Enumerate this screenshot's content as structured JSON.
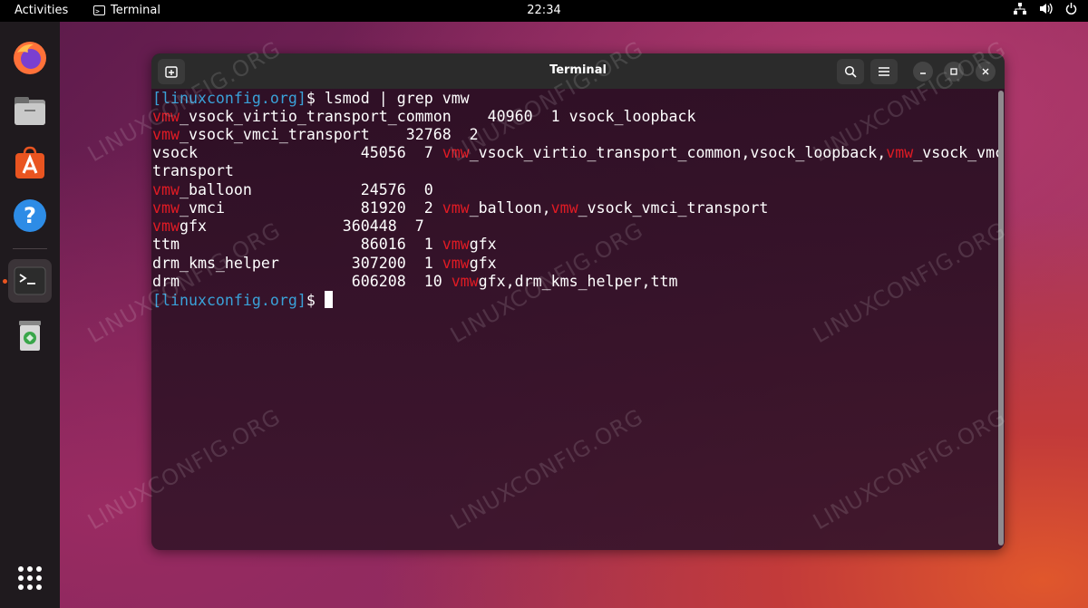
{
  "topbar": {
    "activities": "Activities",
    "app_name": "Terminal",
    "clock": "22:34"
  },
  "dock": {
    "items": [
      "firefox",
      "files",
      "software",
      "help",
      "terminal",
      "trash",
      "show-apps"
    ]
  },
  "window": {
    "title": "Terminal"
  },
  "terminal": {
    "prompt": "[linuxconfig.org]",
    "command": "$ lsmod | grep vmw",
    "lines": [
      {
        "hl1": "vmw",
        "text1": "_vsock_virtio_transport_common    40960  1 vsock_loopback",
        "hl2": "",
        "text2": ""
      },
      {
        "hl1": "vmw",
        "text1": "_vsock_vmci_transport    32768  2",
        "hl2": "",
        "text2": ""
      },
      {
        "pre": "vsock                  45056  7 ",
        "hl1": "vmw",
        "text1": "_vsock_virtio_transport_common,vsock_loopback,",
        "hl2": "vmw",
        "text2": "_vsock_vmci_"
      },
      {
        "pre": "transport"
      },
      {
        "hl1": "vmw",
        "text1": "_balloon            24576  0"
      },
      {
        "hl1": "vmw",
        "text1": "_vmci               81920  2 ",
        "hl2": "vmw",
        "text2": "_balloon,",
        "hl3": "vmw",
        "text3": "_vsock_vmci_transport"
      },
      {
        "hl1": "vmw",
        "text1": "gfx               360448  7"
      },
      {
        "pre": "ttm                    86016  1 ",
        "hl1": "vmw",
        "text1": "gfx"
      },
      {
        "pre": "drm_kms_helper        307200  1 ",
        "hl1": "vmw",
        "text1": "gfx"
      },
      {
        "pre": "drm                   606208  10 ",
        "hl1": "vmw",
        "text1": "gfx,drm_kms_helper,ttm"
      }
    ],
    "final_prompt": "[linuxconfig.org]",
    "final_suffix": "$ "
  },
  "watermark": "LINUXCONFIG.ORG",
  "colors": {
    "prompt": "#3aa1d8",
    "highlight": "#e01b24",
    "accent": "#e95420"
  }
}
